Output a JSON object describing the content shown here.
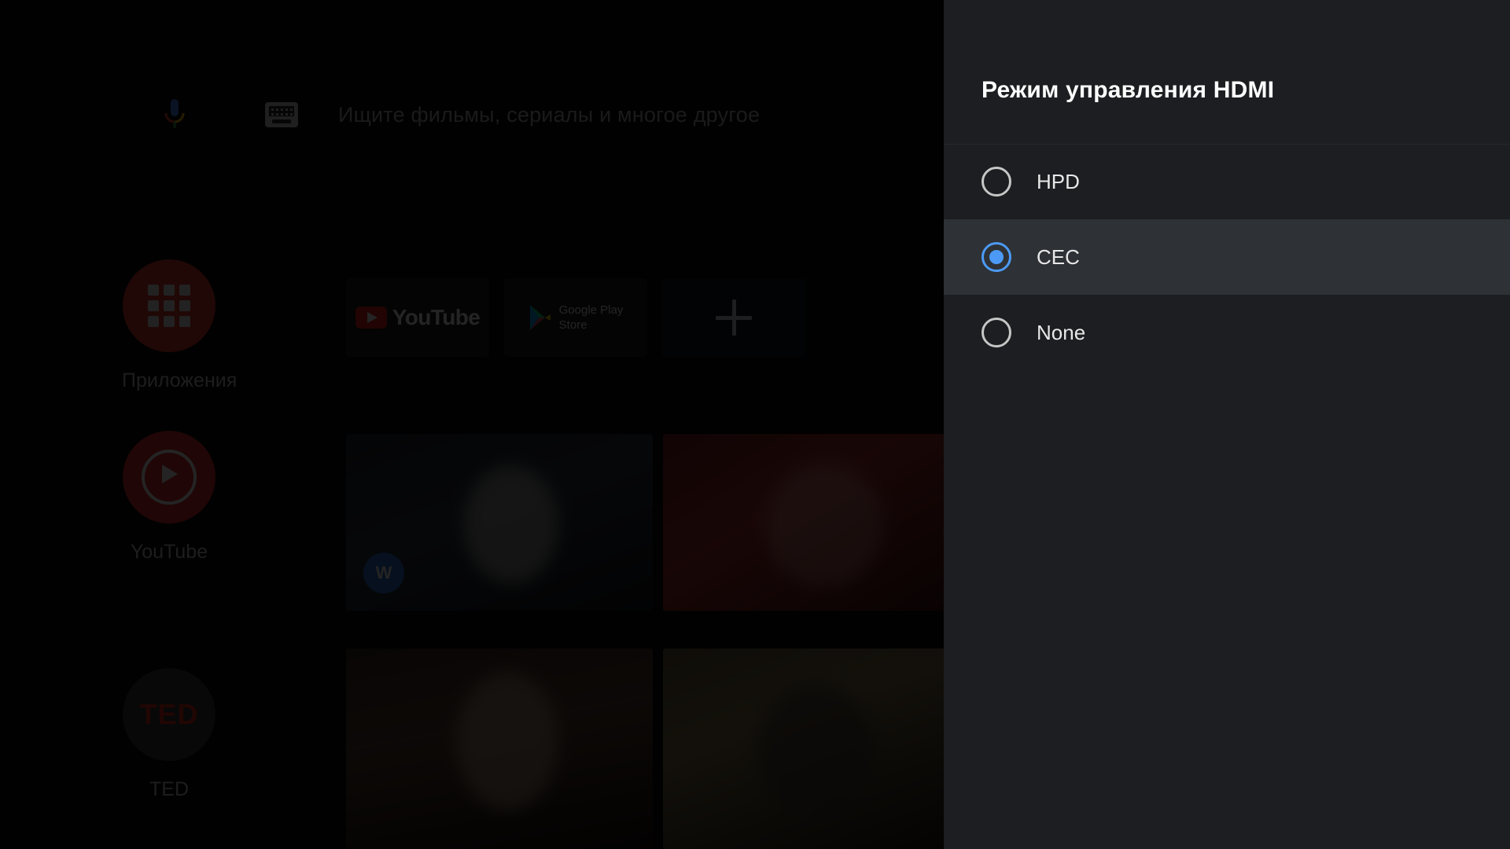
{
  "background_app": {
    "name": "Android TV Home",
    "search": {
      "placeholder": "Ищите фильмы, сериалы и многое другое",
      "mic_icon": "microphone-icon",
      "keyboard_icon": "keyboard-icon"
    },
    "rail": [
      {
        "id": "apps",
        "label": "Приложения",
        "icon": "apps-grid-icon",
        "circle_color": "#e03a2f"
      },
      {
        "id": "youtube",
        "label": "YouTube",
        "icon": "play-circle-icon",
        "circle_color": "#e02f2f"
      },
      {
        "id": "ted",
        "label": "TED",
        "icon": "ted-logo-icon",
        "circle_color": "#3d3d3d",
        "mark": "TED"
      }
    ],
    "app_cards": [
      {
        "id": "youtube",
        "label": "YouTube",
        "icon": "youtube-logo-icon"
      },
      {
        "id": "play-store",
        "label": "Google Play\nStore",
        "icon": "google-play-icon"
      },
      {
        "id": "add",
        "label": "+",
        "icon": "plus-icon"
      }
    ],
    "content_tiles": [
      {
        "id": "r1c1",
        "badge": "W"
      },
      {
        "id": "r1c2",
        "badge": ""
      },
      {
        "id": "r2c1",
        "badge": ""
      },
      {
        "id": "r2c2",
        "badge": ""
      }
    ]
  },
  "dialog": {
    "title": "Режим управления HDMI",
    "selected_value": "CEC",
    "accent_color": "#4c9af5",
    "panel_background": "#1c1e21",
    "selected_row_background": "#2e3135",
    "options": [
      {
        "value": "HPD",
        "label": "HPD",
        "selected": false
      },
      {
        "value": "CEC",
        "label": "CEC",
        "selected": true
      },
      {
        "value": "None",
        "label": "None",
        "selected": false
      }
    ]
  }
}
